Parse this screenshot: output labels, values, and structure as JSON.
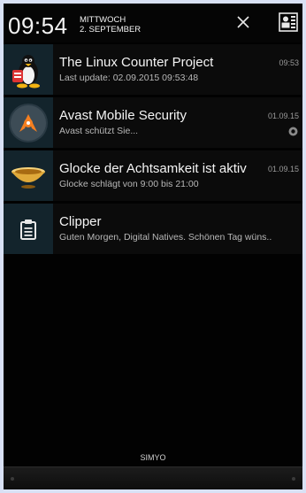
{
  "status_header": {
    "time": "09:54",
    "weekday": "MITTWOCH",
    "date": "2. SEPTEMBER"
  },
  "notifications": [
    {
      "title": "The Linux Counter Project",
      "subtitle": "Last update: 02.09.2015 09:53:48",
      "time": "09:53",
      "icon": "tux-penguin-icon"
    },
    {
      "title": "Avast Mobile Security",
      "subtitle": "Avast schützt Sie...",
      "time": "01.09.15",
      "icon": "avast-logo-icon"
    },
    {
      "title": "Glocke der Achtsamkeit ist aktiv",
      "subtitle": "Glocke schlägt von 9:00 bis 21:00",
      "time": "01.09.15",
      "icon": "singing-bowl-icon"
    },
    {
      "title": "Clipper",
      "subtitle": "Guten Morgen, Digital Natives. Schönen Tag wüns..",
      "icon": "clipboard-icon"
    }
  ],
  "carrier": "SIMYO",
  "colors": {
    "avast_orange": "#f57f20",
    "thumb_bg": "#13242c",
    "bowl_gold": "#e0a93a"
  }
}
